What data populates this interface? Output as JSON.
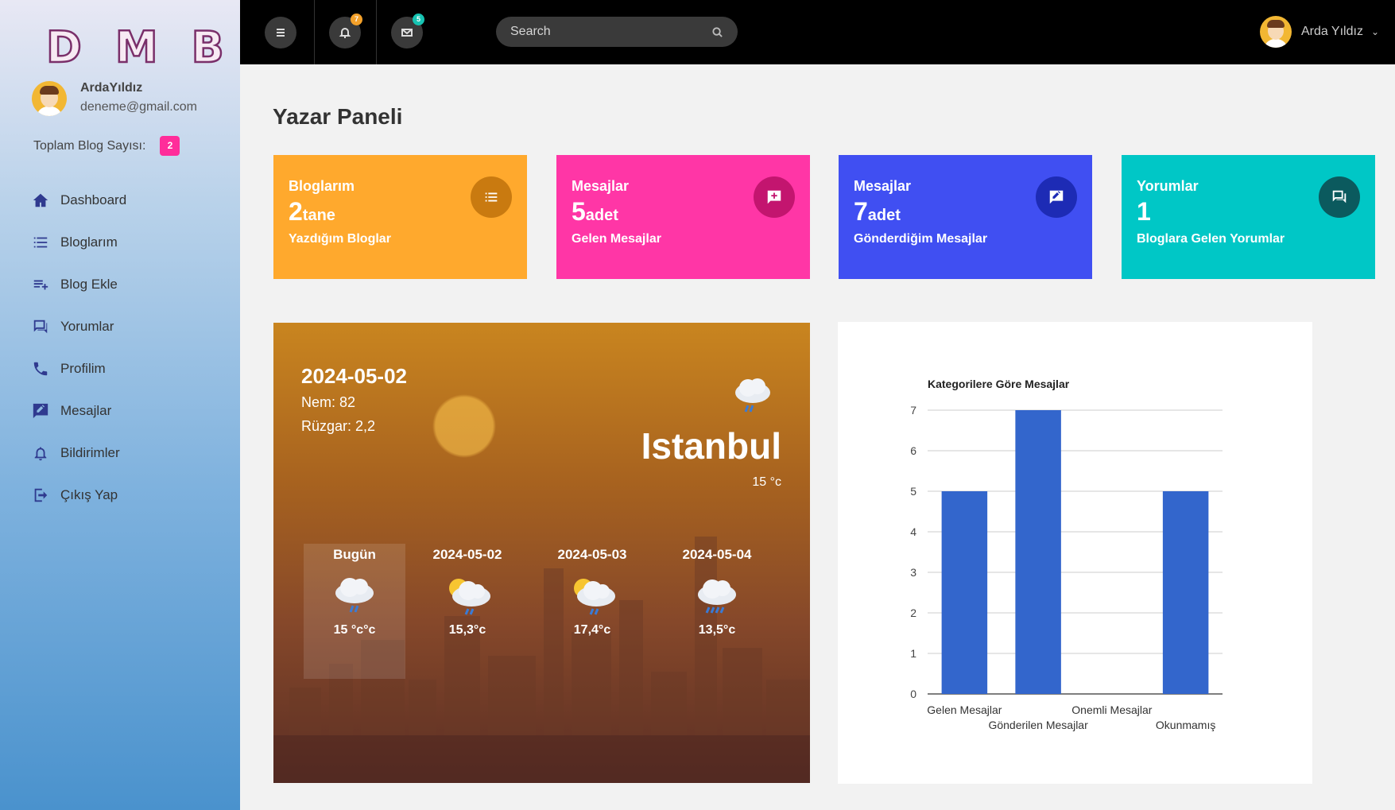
{
  "sidebar": {
    "logo": [
      "D",
      "M",
      "B"
    ],
    "user_name": "ArdaYıldız",
    "user_email": "deneme@gmail.com",
    "blog_count_label": "Toplam Blog Sayısı:",
    "blog_count": "2",
    "items": [
      {
        "label": "Dashboard",
        "icon": "home-icon"
      },
      {
        "label": "Bloglarım",
        "icon": "list-icon"
      },
      {
        "label": "Blog Ekle",
        "icon": "playlist-add-icon"
      },
      {
        "label": "Yorumlar",
        "icon": "comments-icon"
      },
      {
        "label": "Profilim",
        "icon": "phone-icon"
      },
      {
        "label": "Mesajlar",
        "icon": "message-edit-icon"
      },
      {
        "label": "Bildirimler",
        "icon": "bell-icon"
      },
      {
        "label": "Çıkış Yap",
        "icon": "logout-icon"
      }
    ]
  },
  "topbar": {
    "notifications_count": "7",
    "messages_count": "5",
    "search_placeholder": "Search",
    "user_name": "Arda Yıldız",
    "notif_badge_color": "#f4a12a",
    "msg_badge_color": "#17c3b2"
  },
  "main": {
    "title": "Yazar Paneli",
    "cards": [
      {
        "title": "Bloglarım",
        "number": "2",
        "unit": "tane",
        "subtitle": "Yazdığım Bloglar",
        "color": "#ffa92d",
        "icon_bg": "#c97a10",
        "icon": "list-icon"
      },
      {
        "title": "Mesajlar",
        "number": "5",
        "unit": "adet",
        "subtitle": "Gelen Mesajlar",
        "color": "#ff36a6",
        "icon_bg": "#c3156f",
        "icon": "message-plus-icon"
      },
      {
        "title": "Mesajlar",
        "number": "7",
        "unit": "adet",
        "subtitle": "Gönderdiğim Mesajlar",
        "color": "#404ff2",
        "icon_bg": "#1d2bb5",
        "icon": "message-edit-icon"
      },
      {
        "title": "Yorumlar",
        "number": "1",
        "unit": "",
        "subtitle": "Bloglara Gelen Yorumlar",
        "color": "#00c7c6",
        "icon_bg": "#0b5a5e",
        "icon": "comments-icon"
      }
    ]
  },
  "weather": {
    "date": "2024-05-02",
    "humidity": "Nem: 82",
    "wind": "Rüzgar: 2,2",
    "city": "Istanbul",
    "temp": "15 °c",
    "forecast": [
      {
        "day": "Bugün",
        "temp": "15 °c°c",
        "icon": "rain-cloud-icon"
      },
      {
        "day": "2024-05-02",
        "temp": "15,3°c",
        "icon": "sun-rain-cloud-icon"
      },
      {
        "day": "2024-05-03",
        "temp": "17,4°c",
        "icon": "sun-rain-cloud-icon"
      },
      {
        "day": "2024-05-04",
        "temp": "13,5°c",
        "icon": "heavy-rain-cloud-icon"
      }
    ]
  },
  "chart_data": {
    "type": "bar",
    "title": "Kategorilere Göre Mesajlar",
    "categories": [
      "Gelen Mesajlar",
      "Gönderilen Mesajlar",
      "Onemli Mesajlar",
      "Okunmamış"
    ],
    "values": [
      5,
      7,
      0,
      5
    ],
    "ylim": [
      0,
      7
    ],
    "yticks": [
      0,
      1,
      2,
      3,
      4,
      5,
      6,
      7
    ],
    "grid": true,
    "bar_color": "#3366cc"
  }
}
